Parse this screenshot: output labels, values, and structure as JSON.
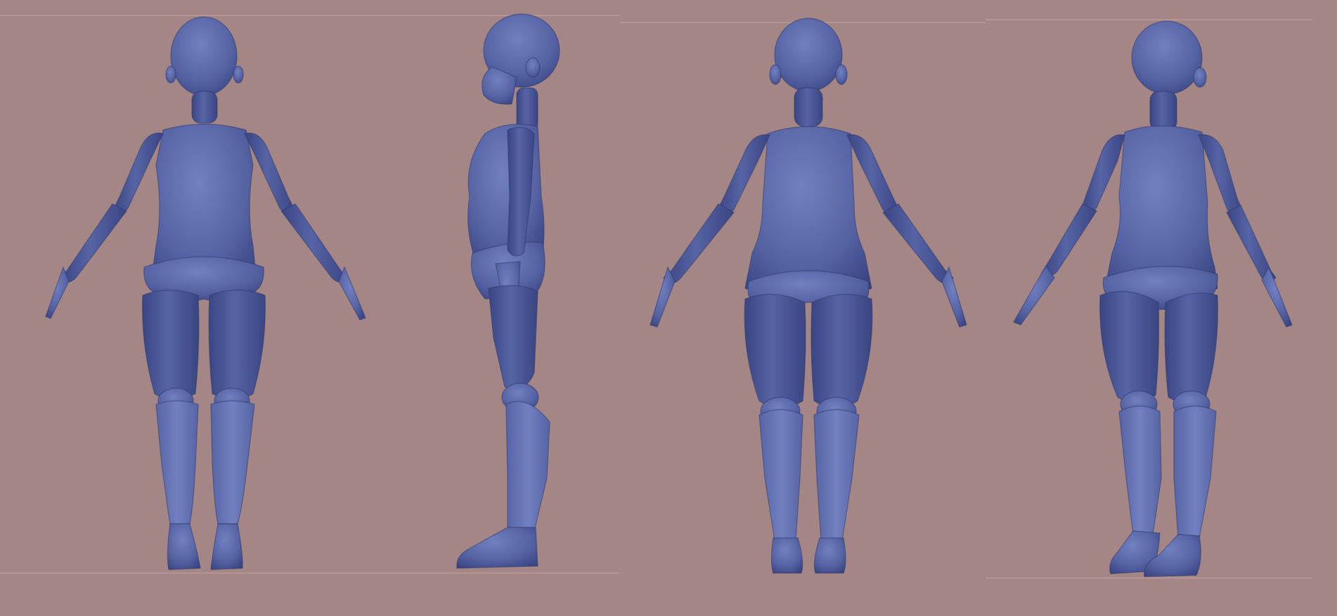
{
  "scene": {
    "background_color": "#a38685",
    "guide_line_color": "#c4a4a2",
    "model_color": "#5664a6",
    "model_dark": "#3a4583",
    "model_light": "#7180c0",
    "model_outline": "#2e386c"
  },
  "views": [
    {
      "name": "front",
      "label": ""
    },
    {
      "name": "side",
      "label": ""
    },
    {
      "name": "back",
      "label": ""
    },
    {
      "name": "three-quarter",
      "label": ""
    }
  ]
}
